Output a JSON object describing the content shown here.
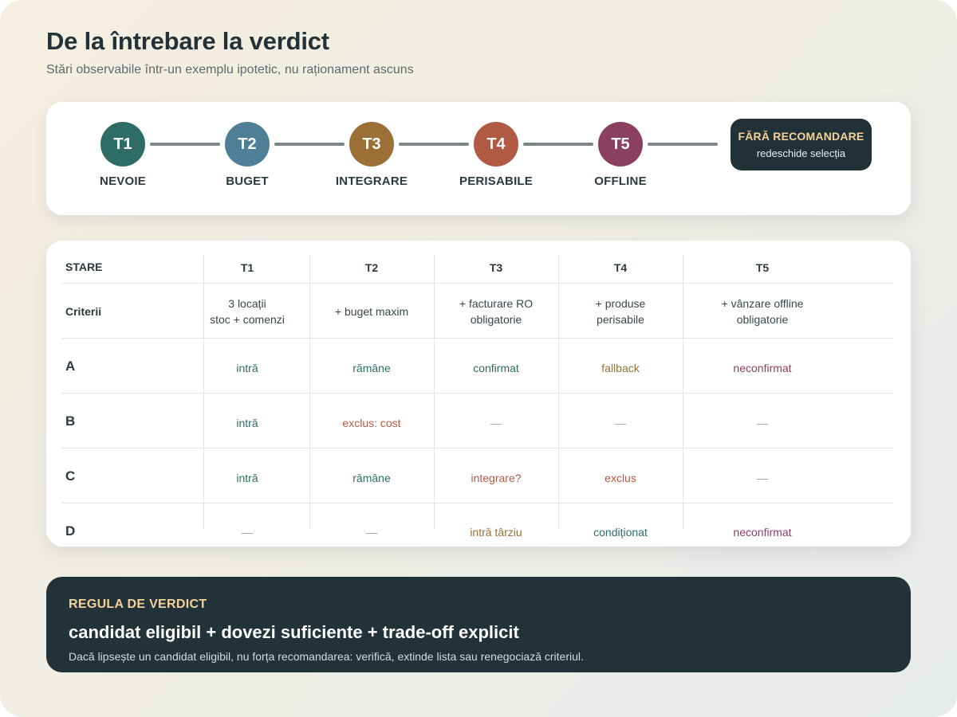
{
  "header": {
    "title": "De la întrebare la verdict",
    "subtitle": "Stări observabile într-un exemplu ipotetic, nu raționament ascuns"
  },
  "timeline": {
    "steps": [
      {
        "id": "T1",
        "label": "NEVOIE",
        "color": "#2e6d65"
      },
      {
        "id": "T2",
        "label": "BUGET",
        "color": "#4e7f96"
      },
      {
        "id": "T3",
        "label": "INTEGRARE",
        "color": "#9b6f35"
      },
      {
        "id": "T4",
        "label": "PERISABILE",
        "color": "#b05a44"
      },
      {
        "id": "T5",
        "label": "OFFLINE",
        "color": "#8c4060"
      }
    ],
    "end": {
      "title": "FĂRĂ RECOMANDARE",
      "subtitle": "redeschide selecția"
    }
  },
  "table": {
    "corner": "STARE",
    "columns": [
      "T1",
      "T2",
      "T3",
      "T4",
      "T5"
    ],
    "criteria_label": "Criterii",
    "criteria": [
      [
        "3 locații",
        "stoc + comenzi"
      ],
      [
        "+ buget maxim"
      ],
      [
        "+ facturare RO",
        "obligatorie"
      ],
      [
        "+ produse",
        "perisabile"
      ],
      [
        "+ vânzare offline",
        "obligatorie"
      ]
    ],
    "rows": [
      {
        "label": "A",
        "cells": [
          "intră",
          "rămâne",
          "confirmat",
          "fallback",
          "neconfirmat"
        ]
      },
      {
        "label": "B",
        "cells": [
          "intră",
          "exclus: cost",
          "—",
          "—",
          "—"
        ]
      },
      {
        "label": "C",
        "cells": [
          "intră",
          "rămâne",
          "integrare?",
          "exclus",
          "—"
        ]
      },
      {
        "label": "D",
        "cells": [
          "—",
          "—",
          "intră târziu",
          "condiționat",
          "neconfirmat"
        ]
      }
    ],
    "status_colors": {
      "positive": "#2e6d65",
      "negative": "#b05a44",
      "warning": "#9b6f35",
      "unconfirmed": "#8c4060",
      "neutral": "#9aa3a6"
    },
    "cell_status": [
      [
        "positive",
        "positive",
        "positive",
        "warning",
        "unconfirmed"
      ],
      [
        "positive",
        "negative",
        "neutral",
        "neutral",
        "neutral"
      ],
      [
        "positive",
        "positive",
        "negative",
        "negative",
        "neutral"
      ],
      [
        "neutral",
        "neutral",
        "warning",
        "positive",
        "unconfirmed"
      ]
    ]
  },
  "verdict": {
    "kicker": "REGULA DE VERDICT",
    "rule": "candidat eligibil + dovezi suficiente + trade-off explicit",
    "note": "Dacă lipsește un candidat eligibil, nu forța recomandarea: verifică, extinde lista sau renegociază criteriul."
  }
}
